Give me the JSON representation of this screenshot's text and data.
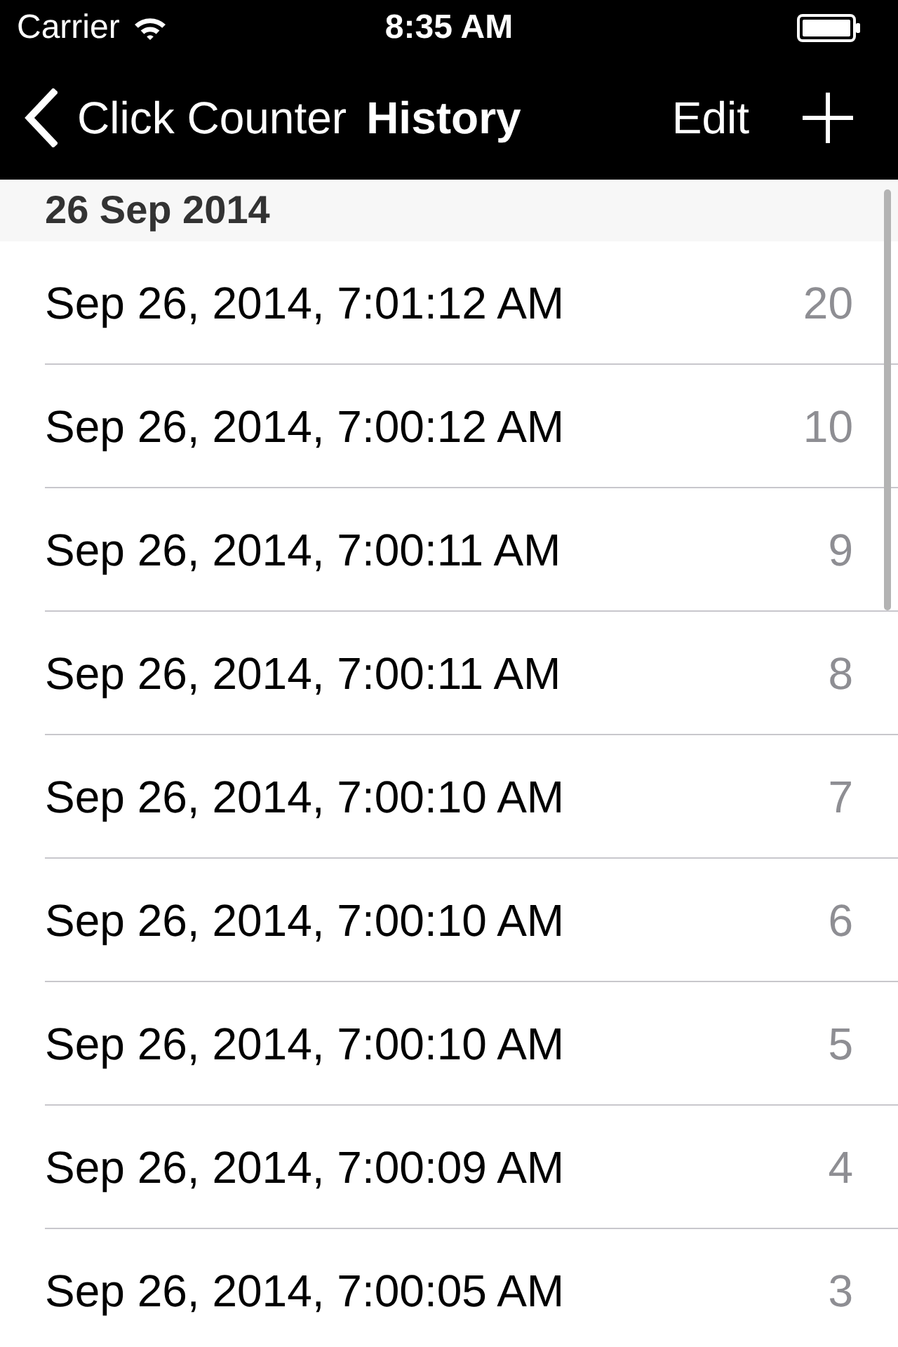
{
  "status_bar": {
    "carrier": "Carrier",
    "time": "8:35 AM"
  },
  "nav_bar": {
    "back_label": "Click Counter",
    "title": "History",
    "edit": "Edit"
  },
  "sections": [
    {
      "title": "26 Sep 2014",
      "rows": [
        {
          "date": "Sep 26, 2014, 7:01:12 AM",
          "count": "20"
        },
        {
          "date": "Sep 26, 2014, 7:00:12 AM",
          "count": "10"
        },
        {
          "date": "Sep 26, 2014, 7:00:11 AM",
          "count": "9"
        },
        {
          "date": "Sep 26, 2014, 7:00:11 AM",
          "count": "8"
        },
        {
          "date": "Sep 26, 2014, 7:00:10 AM",
          "count": "7"
        },
        {
          "date": "Sep 26, 2014, 7:00:10 AM",
          "count": "6"
        },
        {
          "date": "Sep 26, 2014, 7:00:10 AM",
          "count": "5"
        },
        {
          "date": "Sep 26, 2014, 7:00:09 AM",
          "count": "4"
        },
        {
          "date": "Sep 26, 2014, 7:00:05 AM",
          "count": "3"
        }
      ]
    }
  ]
}
